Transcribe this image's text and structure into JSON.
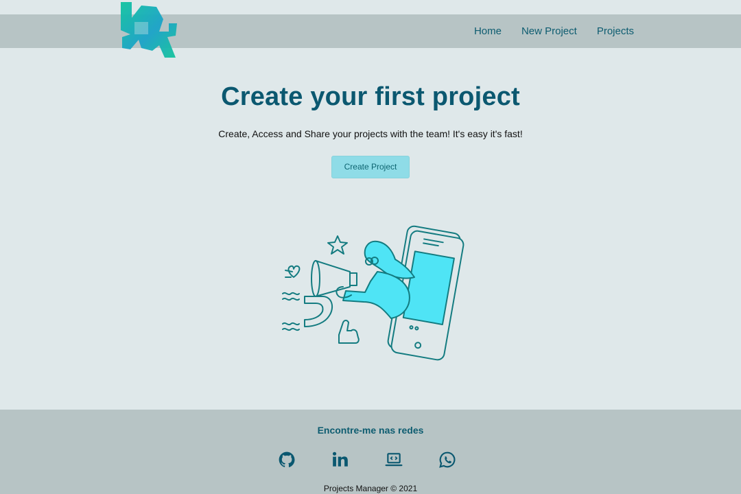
{
  "nav": {
    "logo": "logo-icon",
    "links": [
      "Home",
      "New Project",
      "Projects"
    ]
  },
  "hero": {
    "title": "Create your first project",
    "subtitle": "Create, Access and Share your projects with the team! It's easy it's fast!",
    "cta_label": "Create Project",
    "illustration": "megaphone-phone-illustration"
  },
  "footer": {
    "heading": "Encontre-me nas redes",
    "social": [
      "github-icon",
      "linkedin-icon",
      "portfolio-icon",
      "whatsapp-icon"
    ],
    "copyright": "Projects Manager © 2021"
  },
  "colors": {
    "background": "#dfe8ea",
    "bars": "#b7c4c5",
    "brand": "#0b5870",
    "button": "#8fdce7",
    "accent": "#1ab0a0"
  }
}
